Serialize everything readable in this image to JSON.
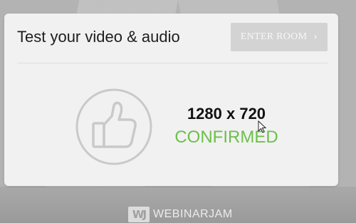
{
  "dialog": {
    "title": "Test your video & audio",
    "enter_button_label": "ENTER ROOM",
    "enter_button_icon": "chevron-right-icon"
  },
  "status": {
    "resolution": "1280 x 720",
    "state": "CONFIRMED",
    "state_color": "#6cc04a",
    "icon": "thumbs-up-icon"
  },
  "branding": {
    "logo_mark": "WJ",
    "name": "WEBINARJAM"
  }
}
